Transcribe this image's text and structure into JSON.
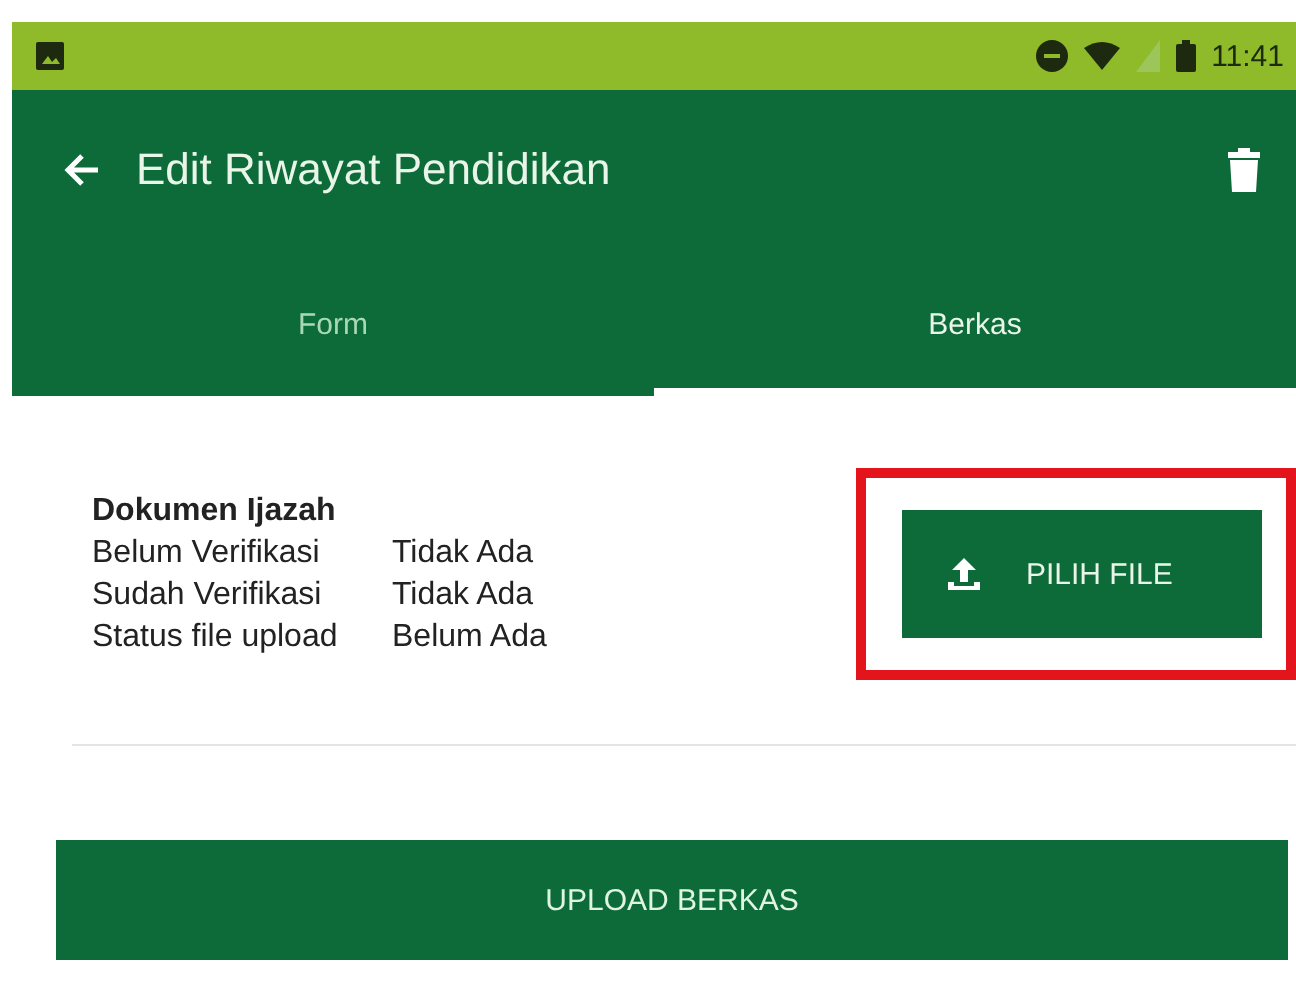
{
  "status_bar": {
    "time": "11:41"
  },
  "app_bar": {
    "title": "Edit Riwayat Pendidikan"
  },
  "tabs": [
    {
      "label": "Form",
      "selected": false
    },
    {
      "label": "Berkas",
      "selected": true
    }
  ],
  "document": {
    "title": "Dokumen Ijazah",
    "rows": [
      {
        "label": "Belum Verifikasi",
        "value": "Tidak Ada"
      },
      {
        "label": "Sudah Verifikasi",
        "value": "Tidak Ada"
      },
      {
        "label": "Status file upload",
        "value": "Belum Ada"
      }
    ],
    "pick_button": {
      "label": "PILIH FILE",
      "highlighted": true
    }
  },
  "upload_button": {
    "label": "UPLOAD BERKAS"
  }
}
